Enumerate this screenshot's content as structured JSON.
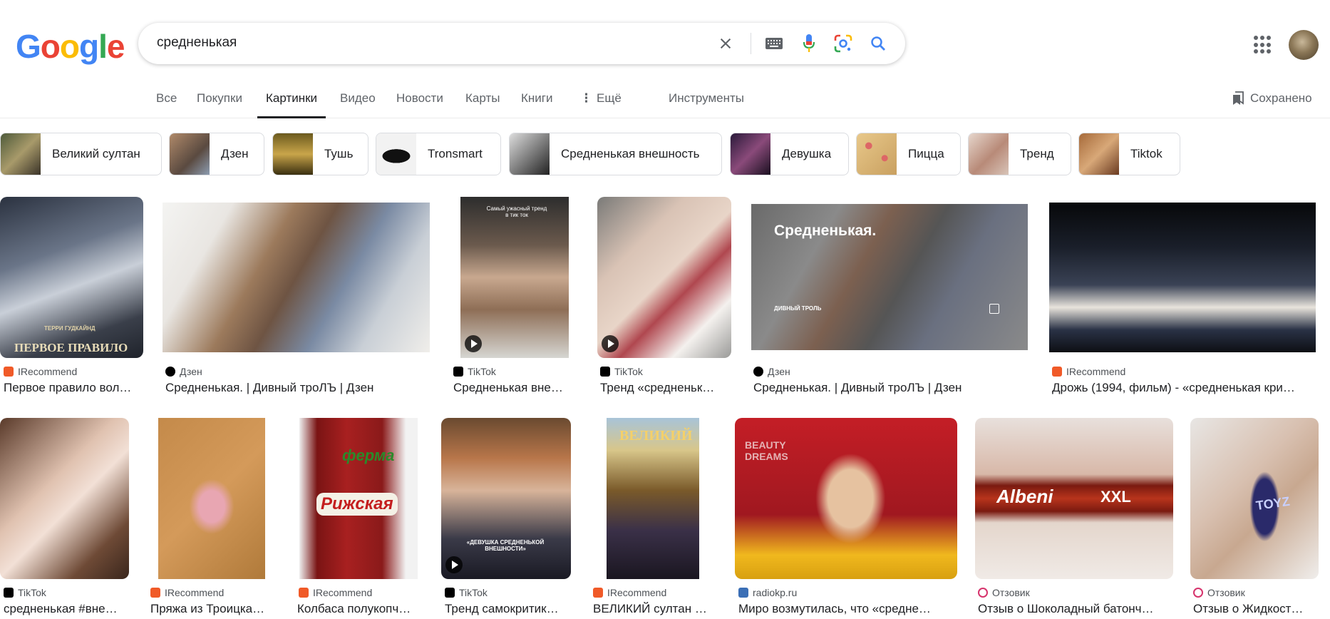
{
  "logo": {
    "letters": [
      "G",
      "o",
      "o",
      "g",
      "l",
      "e"
    ],
    "colors": [
      "#4285F4",
      "#EA4335",
      "#FBBC05",
      "#4285F4",
      "#34A853",
      "#EA4335"
    ]
  },
  "search": {
    "query": "средненькая",
    "icons": [
      "close-icon",
      "keyboard-icon",
      "microphone-icon",
      "lens-icon",
      "search-icon"
    ]
  },
  "tabs": {
    "all": "Все",
    "shopping": "Покупки",
    "images": "Картинки",
    "videos": "Видео",
    "news": "Новости",
    "maps": "Карты",
    "books": "Книги",
    "more": "Ещё",
    "tools": "Инструменты",
    "saved": "Сохранено"
  },
  "chips": [
    "Великий султан",
    "Дзен",
    "Тушь",
    "Tronsmart",
    "Средненькая внешность",
    "Девушка",
    "Пицца",
    "Тренд",
    "Tiktok"
  ],
  "results_row1": [
    {
      "source": "IRecommend",
      "title": "Первое правило вол…",
      "overlay": "ПЕРВОЕ ПРАВИЛО",
      "overlay_small": "ТЕРРИ ГУДКАЙНД"
    },
    {
      "source": "Дзен",
      "title": "Средненькая. | Дивный троЛЪ | Дзен"
    },
    {
      "source": "TikTok",
      "title": "Средненькая вне…",
      "overlay": "Самый ужасный тренд в тик ток"
    },
    {
      "source": "TikTok",
      "title": "Тренд «средненьк…"
    },
    {
      "source": "Дзен",
      "title": "Средненькая. | Дивный троЛЪ | Дзен",
      "overlay": "Средненькая.",
      "overlay_small": "ДИВНЫЙ ТРОЛЬ"
    },
    {
      "source": "IRecommend",
      "title": "Дрожь (1994, фильм) - «средненькая кри…"
    }
  ],
  "results_row2": [
    {
      "source": "TikTok",
      "title": "средненькая #вне…"
    },
    {
      "source": "IRecommend",
      "title": "Пряжа из Троицка…"
    },
    {
      "source": "IRecommend",
      "title": "Колбаса полукопч…",
      "overlay": "Рижская",
      "overlay_small": "ферма"
    },
    {
      "source": "TikTok",
      "title": "Тренд самокритик…",
      "overlay": "«ДЕВУШКА СРЕДНЕНЬКОЙ ВНЕШНОСТИ»"
    },
    {
      "source": "IRecommend",
      "title": "ВЕЛИКИЙ султан …",
      "overlay": "ВЕЛИКИЙ"
    },
    {
      "source": "radiokp.ru",
      "title": "Миро возмутилась, что «средне…",
      "overlay": "BEAUTY DREAMS"
    },
    {
      "source": "Отзовик",
      "title": "Отзыв о Шоколадный батонч…",
      "overlay": "Albeni",
      "overlay_small": "XXL"
    },
    {
      "source": "Отзовик",
      "title": "Отзыв о Жидкост…",
      "overlay": "TOYZ"
    }
  ],
  "colors": {
    "irecommend": "#f05a28",
    "dzen": "#000000",
    "tiktok": "#000000",
    "otzovik": "#d6336c",
    "radiokp": "#3b6fb6"
  }
}
